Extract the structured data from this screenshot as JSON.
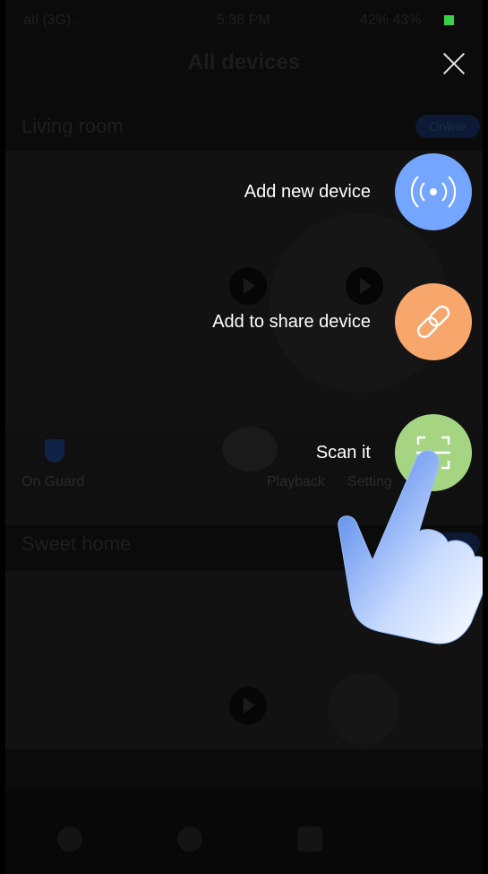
{
  "status_bar": {
    "carrier": "atl (3G) .",
    "time": "5:38 PM",
    "battery": "42% 43%"
  },
  "header": {
    "title": "All devices"
  },
  "background": {
    "group1": {
      "title": "Living room",
      "badge": "Online"
    },
    "toolbar": {
      "on_guard": "On Guard",
      "playback": "Playback",
      "settings": "Setting"
    },
    "group2": {
      "title": "Sweet home"
    }
  },
  "menu": {
    "items": [
      {
        "label": "Add new device",
        "icon": "radar-signal-icon",
        "color": "#74a5ff"
      },
      {
        "label": "Add to share device",
        "icon": "link-icon",
        "color": "#f7a76b"
      },
      {
        "label": "Scan it",
        "icon": "scan-frame-icon",
        "color": "#a5d483"
      }
    ]
  }
}
